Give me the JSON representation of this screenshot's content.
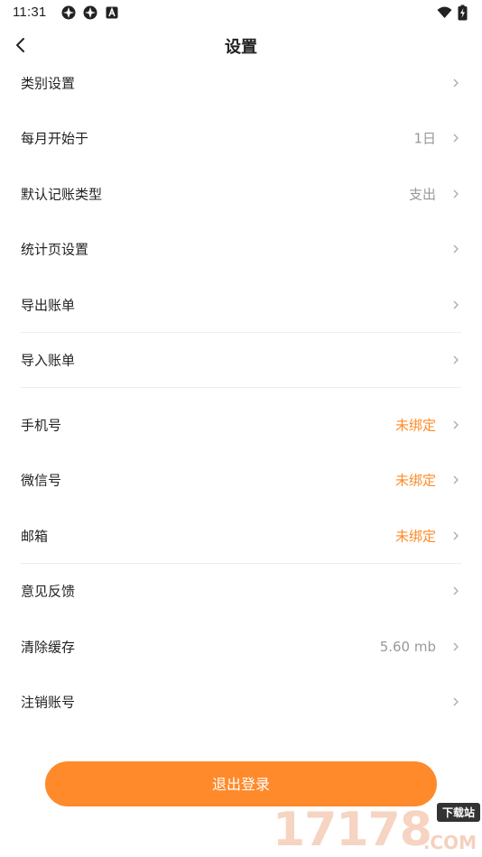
{
  "status_bar": {
    "time": "11:31",
    "icons": [
      "app-notification-icon",
      "app-notification-icon",
      "android-debug-icon",
      "wifi-icon",
      "battery-charging-icon"
    ]
  },
  "header": {
    "title": "设置",
    "back_icon": "chevron-left-icon"
  },
  "settings": {
    "rows": [
      {
        "label": "类别设置",
        "value": ""
      },
      {
        "label": "每月开始于",
        "value": "1日"
      },
      {
        "label": "默认记账类型",
        "value": "支出"
      },
      {
        "label": "统计页设置",
        "value": ""
      },
      {
        "label": "导出账单",
        "value": ""
      },
      {
        "label": "导入账单",
        "value": ""
      },
      {
        "label": "手机号",
        "value": "未绑定"
      },
      {
        "label": "微信号",
        "value": "未绑定"
      },
      {
        "label": "邮箱",
        "value": "未绑定"
      },
      {
        "label": "意见反馈",
        "value": ""
      },
      {
        "label": "清除缓存",
        "value": "5.60 mb"
      },
      {
        "label": "注销账号",
        "value": ""
      }
    ]
  },
  "logout": {
    "label": "退出登录"
  },
  "watermark": {
    "digits": "17178",
    "badge": "下载站",
    "suffix": ".COM"
  },
  "colors": {
    "accent": "#ff8a25",
    "button": "#ff8a2b",
    "secondary_text": "#999999",
    "divider": "#ededed"
  }
}
